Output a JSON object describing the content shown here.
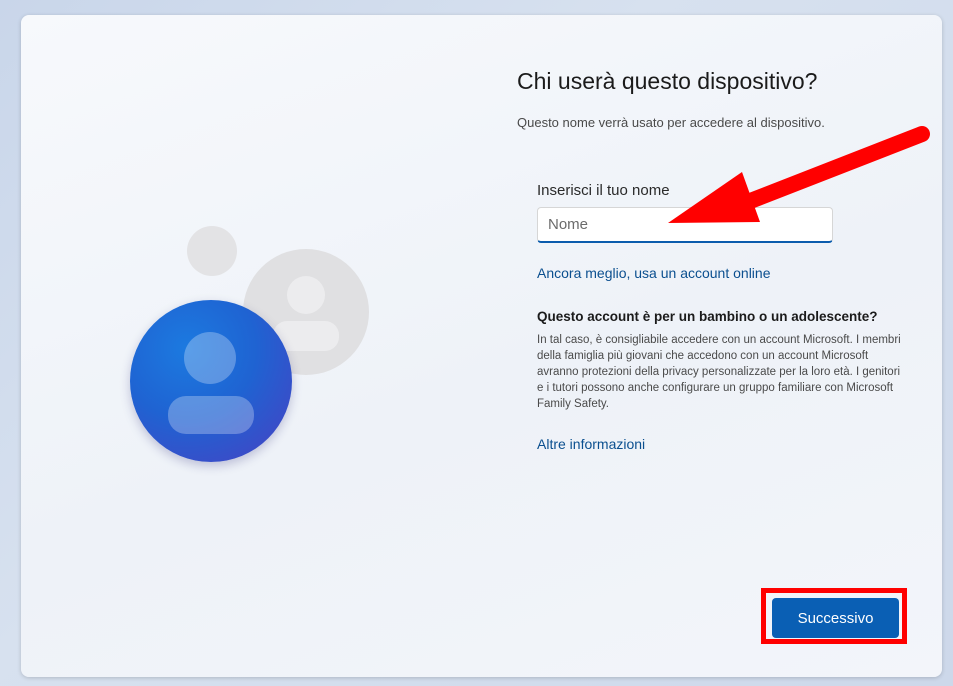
{
  "page": {
    "title": "Chi userà questo dispositivo?",
    "subtitle": "Questo nome verrà usato per accedere al dispositivo."
  },
  "name_field": {
    "label": "Inserisci il tuo nome",
    "placeholder": "Nome",
    "value": ""
  },
  "online_account_link": "Ancora meglio, usa un account online",
  "child_section": {
    "heading": "Questo account è per un bambino o un adolescente?",
    "description": "In tal caso, è consigliabile accedere con un account Microsoft. I membri della famiglia più giovani che accedono con un account Microsoft avranno protezioni della privacy personalizzate per la loro età. I genitori e i tutori possono anche configurare un gruppo familiare con Microsoft Family Safety.",
    "more_info_link": "Altre informazioni"
  },
  "buttons": {
    "next": "Successivo"
  },
  "icons": {
    "primary_avatar": "user-avatar-icon",
    "secondary_avatar": "user-avatar-icon"
  },
  "colors": {
    "accent": "#0a5fb4",
    "link": "#0b4f8f",
    "annotation": "#ff0000"
  }
}
